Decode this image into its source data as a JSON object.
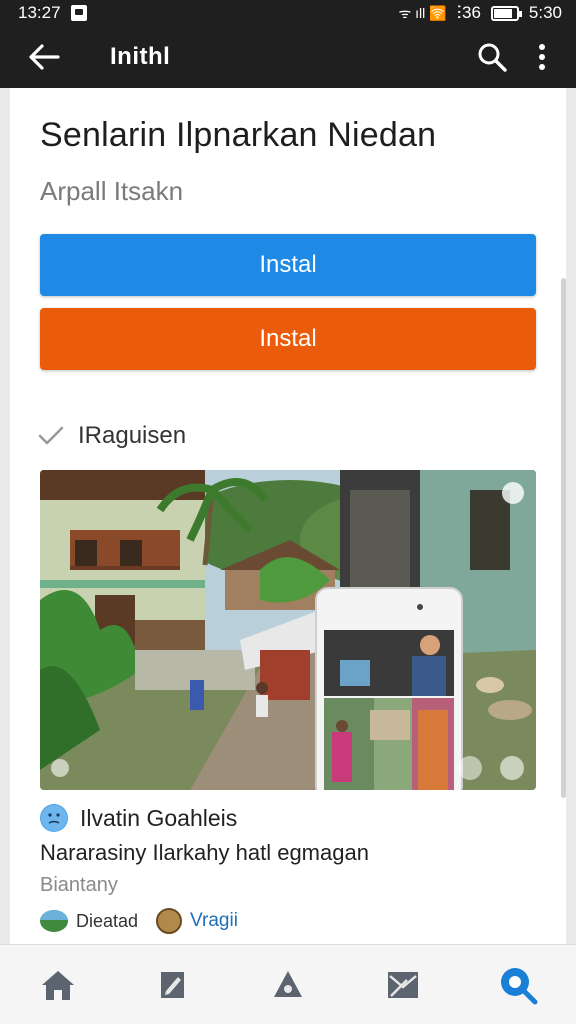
{
  "status_bar": {
    "time_left": "13:27",
    "network_text": "ᯤ ıll 🛜",
    "carrier_text": "ⵗ36",
    "time_right": "5:30"
  },
  "app_bar": {
    "title": "Inithl",
    "back_icon": "arrow-left-icon",
    "search_icon": "search-icon",
    "more_icon": "more-vertical-icon"
  },
  "page": {
    "title": "Senlarin Ilpnarkan Niedan",
    "subtitle": "Arpall Itsakn",
    "primary_button": "Instal",
    "secondary_button": "Instal",
    "section_label": "IRaguisen"
  },
  "post": {
    "author": "Ilvatin Goahleis",
    "description": "Nararasiny Ilarkahy hatl egmagan",
    "sub": "Biantany",
    "meta_a": "Dieatad",
    "meta_b": "Vragii"
  },
  "bottom_nav": {
    "items": [
      "home-icon",
      "edit-icon",
      "drop-icon",
      "mail-icon",
      "search-icon"
    ],
    "active": 4
  },
  "colors": {
    "bar_bg": "#1f1f1f",
    "primary_blue": "#1e8ae6",
    "accent_orange": "#ea5b0c",
    "link_blue": "#1e6fb8"
  }
}
